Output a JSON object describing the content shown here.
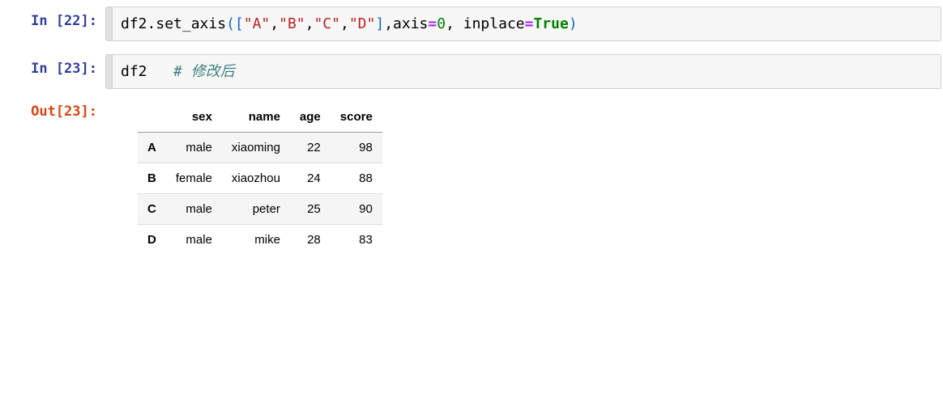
{
  "cells": [
    {
      "prompt_label": "In [22]:",
      "code": {
        "p0": "df2",
        "p1": ".",
        "p2": "set_axis",
        "p3": "(",
        "p4": "[",
        "p5": "\"A\"",
        "p6": ",",
        "p7": "\"B\"",
        "p8": ",",
        "p9": "\"C\"",
        "p10": ",",
        "p11": "\"D\"",
        "p12": "]",
        "p13": ",",
        "p14": "axis",
        "p15": "=",
        "p16": "0",
        "p17": ",",
        "p18": " inplace",
        "p19": "=",
        "p20": "True",
        "p21": ")"
      }
    },
    {
      "prompt_label": "In [23]:",
      "code": {
        "p0": "df2",
        "p1": "   ",
        "p2": "# 修改后"
      }
    }
  ],
  "output": {
    "prompt_label": "Out[23]:",
    "columns": [
      "sex",
      "name",
      "age",
      "score"
    ],
    "index": [
      "A",
      "B",
      "C",
      "D"
    ],
    "rows": [
      {
        "sex": "male",
        "name": "xiaoming",
        "age": "22",
        "score": "98"
      },
      {
        "sex": "female",
        "name": "xiaozhou",
        "age": "24",
        "score": "88"
      },
      {
        "sex": "male",
        "name": "peter",
        "age": "25",
        "score": "90"
      },
      {
        "sex": "male",
        "name": "mike",
        "age": "28",
        "score": "83"
      }
    ]
  }
}
